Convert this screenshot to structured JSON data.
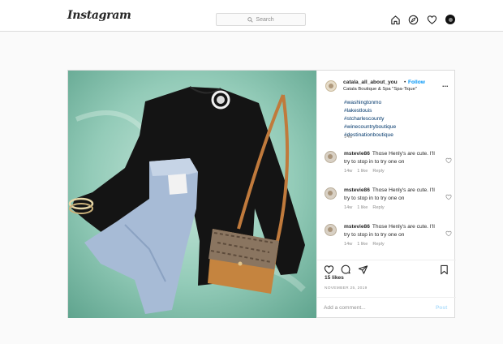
{
  "nav": {
    "logo": "Instagram",
    "search_placeholder": "Search",
    "icons": [
      "home-icon",
      "explore-icon",
      "heart-icon",
      "profile-avatar"
    ]
  },
  "post": {
    "username": "catala_all_about_you",
    "dot": "•",
    "follow": "Follow",
    "location": "Catala Boutique & Spa \"Spa-Tique\"",
    "more": "...",
    "caption_tags": [
      "#washingtonmo",
      "#lakestlouis",
      "#stcharlescounty",
      "#winecountryboutique",
      "#destinationboutique"
    ],
    "caption_time": "14w",
    "comments": [
      {
        "user": "mstevie86",
        "text": "Those Henly's are cute. I'll try to stop in to try one on",
        "time": "14w",
        "likes": "1 like",
        "reply": "Reply"
      },
      {
        "user": "mstevie86",
        "text": "Those Henly's are cute. I'll try to stop in to try one on",
        "time": "14w",
        "likes": "1 like",
        "reply": "Reply"
      },
      {
        "user": "mstevie86",
        "text": "Those Henly's are cute. I'll try to stop in to try one on",
        "time": "14w",
        "likes": "1 like",
        "reply": "Reply"
      }
    ],
    "likes": "15 likes",
    "date": "NOVEMBER 25, 2019",
    "add_comment_placeholder": "Add a comment...",
    "post_button": "Post"
  },
  "colors": {
    "link": "#0095f6",
    "hashtag": "#00376b",
    "muted": "#8e8e8e",
    "border": "#dbdbdb",
    "photo_bg": "#8fc4b3"
  }
}
